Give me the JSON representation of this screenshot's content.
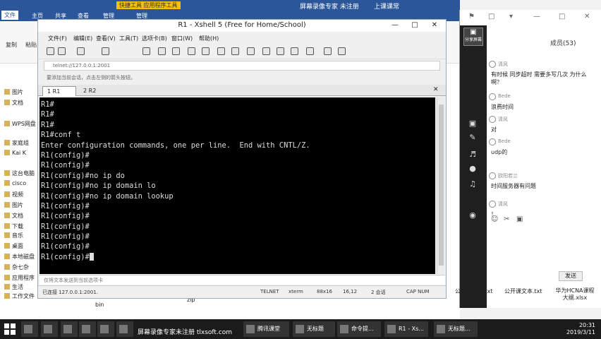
{
  "explorer": {
    "ribbon_tabs": [
      "文件",
      "主页",
      "共享",
      "查看",
      "管理",
      "管理"
    ],
    "quick_tools_label": "快捷工具",
    "app_tools_label": "应用程序工具",
    "title": "屏幕录像专家 未注册",
    "title_right": "上课课常",
    "ribbon_copy": "复制",
    "ribbon_paste": "粘贴",
    "nav_items": [
      "图片",
      "文档",
      "WPS网盘",
      "家庭组",
      "Kai K",
      "这台电脑",
      "cisco",
      "视频",
      "图片",
      "文档",
      "下载",
      "音乐",
      "桌面",
      "本地磁盘",
      "杂七杂",
      "应用程序",
      "生活",
      "工作文件"
    ],
    "bg_file_bin": "bin",
    "bg_file_zip": "zip"
  },
  "xshell": {
    "title": "R1 - Xshell 5 (Free for Home/School)",
    "menu": [
      "文件(F)",
      "编辑(E)",
      "查看(V)",
      "工具(T)",
      "选项卡(B)",
      "窗口(W)",
      "帮助(H)"
    ],
    "address": "telnet://127.0.0.1:2001",
    "hint": "要添加当前会话，点击左侧的箭头按钮。",
    "tabs": [
      "1 R1",
      "2 R2"
    ],
    "terminal_lines": [
      "R1#",
      "R1#",
      "R1#",
      "R1#conf t",
      "Enter configuration commands, one per line.  End with CNTL/Z.",
      "R1(config)#",
      "R1(config)#",
      "R1(config)#no ip do",
      "R1(config)#no ip domain lo",
      "R1(config)#no ip domain lookup",
      "R1(config)#",
      "R1(config)#",
      "R1(config)#",
      "R1(config)#",
      "R1(config)#",
      "R1(config)#"
    ],
    "input_placeholder": "仅将文本发送到当前选项卡",
    "status": {
      "connection": "已连接 127.0.0.1:2001.",
      "protocol": "TELNET",
      "terminal": "xterm",
      "size": "88x16",
      "position": "16,12",
      "sessions": "2 会话",
      "caps": "CAP NUM"
    }
  },
  "chat": {
    "members": "成员(53)",
    "share_label": "分享屏幕",
    "messages": [
      {
        "name": "清风",
        "text": "有时候 同步超时  需要多写几次  为什么啊？"
      },
      {
        "name": "Bede",
        "text": "浪费时间"
      },
      {
        "name": "清风",
        "text": "对"
      },
      {
        "name": "Bede",
        "text": "udp的"
      },
      {
        "name": "欧阳若兰",
        "text": "时间服务器有问题"
      },
      {
        "name": "清风",
        "text": "！"
      }
    ],
    "send_label": "发送"
  },
  "desktop_files": [
    {
      "name": "公开课提纲.txt"
    },
    {
      "name": "公开课文本.txt"
    },
    {
      "name": "华为HCNA课程大纲.xlsx"
    }
  ],
  "taskbar": {
    "items": [
      "",
      "",
      "",
      "",
      "",
      "",
      "腾讯课堂",
      "无标题",
      "命令提...",
      "R1 - Xs...",
      "无标题..."
    ],
    "watermark": "屏幕录像专家未注册 tlxsoft.com",
    "time": "20:31",
    "date": "2019/3/11"
  }
}
